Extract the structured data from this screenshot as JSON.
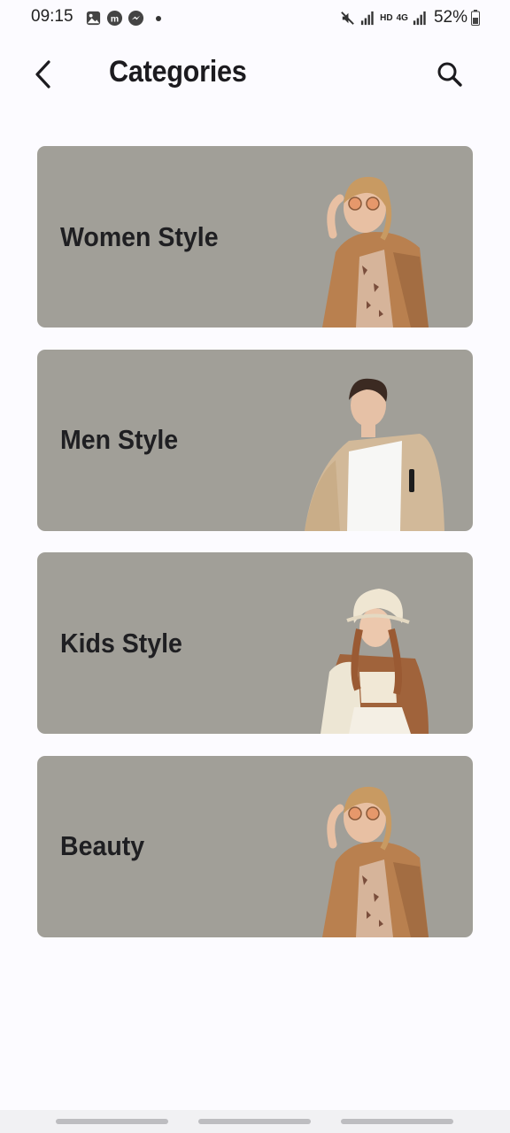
{
  "status_bar": {
    "time": "09:15",
    "network_label": "HD",
    "network_type": "4G",
    "battery": "52%",
    "icons": [
      "gallery-icon",
      "app-m-icon",
      "messenger-icon",
      "mute-icon",
      "signal-icon",
      "battery-icon"
    ]
  },
  "header": {
    "title": "Categories",
    "back_icon": "chevron-left-icon",
    "search_icon": "search-icon"
  },
  "categories": [
    {
      "label": "Women Style",
      "image": "woman-in-camel-blazer"
    },
    {
      "label": "Men Style",
      "image": "man-in-fleece-jacket"
    },
    {
      "label": "Kids Style",
      "image": "girl-in-bucket-hat"
    },
    {
      "label": "Beauty",
      "image": "woman-in-camel-blazer"
    }
  ],
  "colors": {
    "background": "#fcfbff",
    "card": "#a19f98",
    "text": "#1c1b1f"
  }
}
